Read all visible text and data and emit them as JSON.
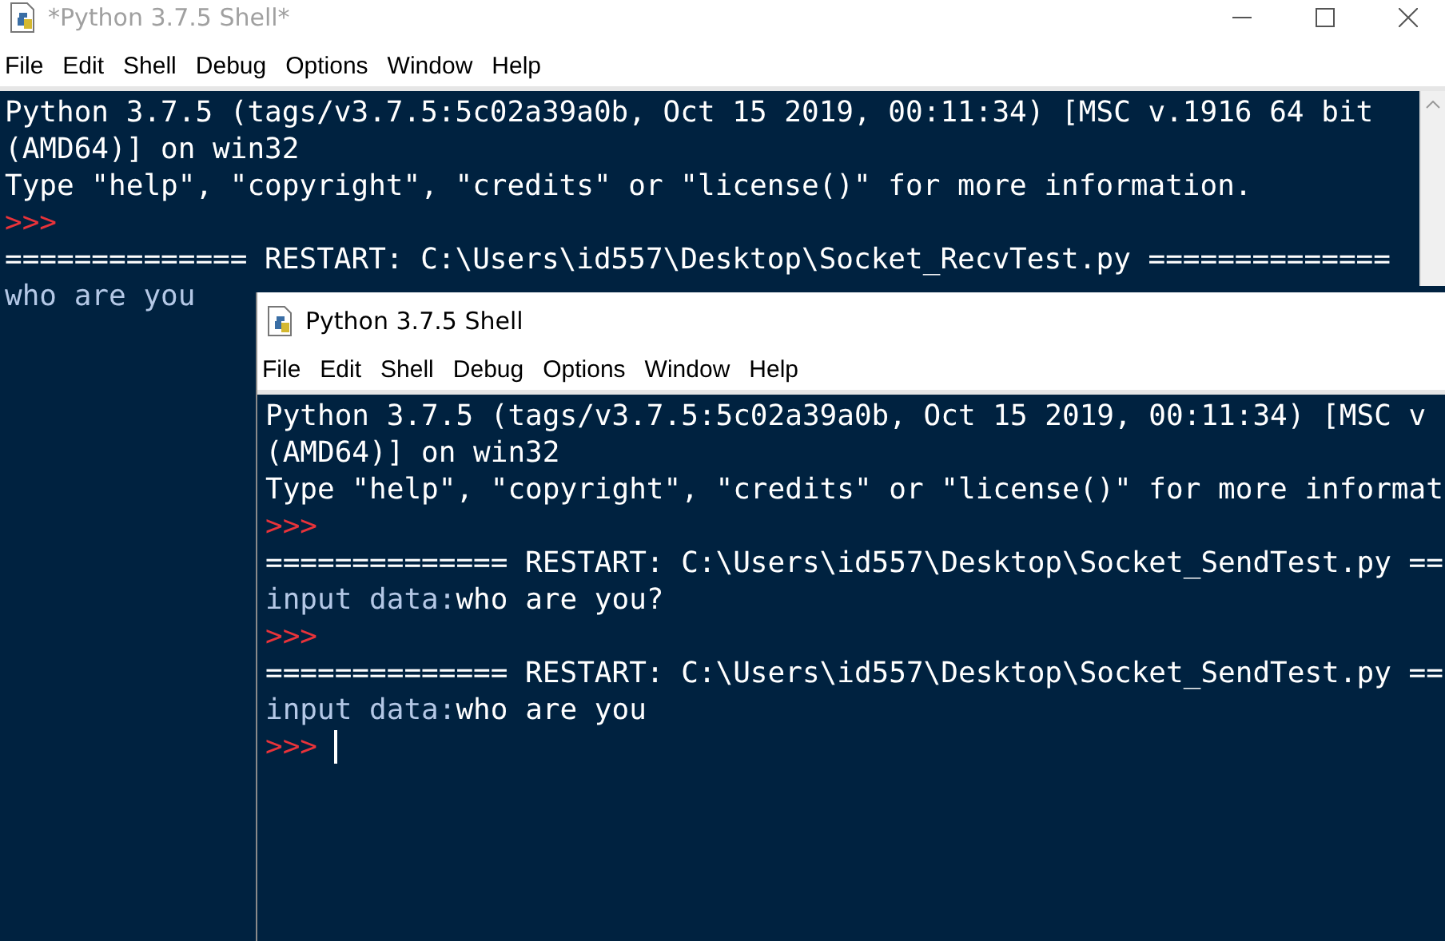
{
  "windows": [
    {
      "title": "*Python 3.7.5 Shell*",
      "active": false,
      "controls_visible": true,
      "scrollbar_visible": true,
      "menu": [
        "File",
        "Edit",
        "Shell",
        "Debug",
        "Options",
        "Window",
        "Help"
      ],
      "lines": [
        [
          {
            "kind": "console",
            "text": "Python 3.7.5 (tags/v3.7.5:5c02a39a0b, Oct 15 2019, 00:11:34) [MSC v.1916 64 bit"
          }
        ],
        [
          {
            "kind": "console",
            "text": "(AMD64)] on win32"
          }
        ],
        [
          {
            "kind": "console",
            "text": "Type \"help\", \"copyright\", \"credits\" or \"license()\" for more information."
          }
        ],
        [
          {
            "kind": "prompt",
            "text": ">>>"
          }
        ],
        [
          {
            "kind": "console",
            "text": "============== RESTART: C:\\Users\\id557\\Desktop\\Socket_RecvTest.py =============="
          }
        ],
        [
          {
            "kind": "stdout",
            "text": "who are you"
          }
        ]
      ]
    },
    {
      "title": "Python 3.7.5 Shell",
      "active": true,
      "controls_visible": false,
      "scrollbar_visible": false,
      "menu": [
        "File",
        "Edit",
        "Shell",
        "Debug",
        "Options",
        "Window",
        "Help"
      ],
      "lines": [
        [
          {
            "kind": "console",
            "text": "Python 3.7.5 (tags/v3.7.5:5c02a39a0b, Oct 15 2019, 00:11:34) [MSC v"
          }
        ],
        [
          {
            "kind": "console",
            "text": "(AMD64)] on win32"
          }
        ],
        [
          {
            "kind": "console",
            "text": "Type \"help\", \"copyright\", \"credits\" or \"license()\" for more informat"
          }
        ],
        [
          {
            "kind": "prompt",
            "text": ">>>"
          }
        ],
        [
          {
            "kind": "console",
            "text": "============== RESTART: C:\\Users\\id557\\Desktop\\Socket_SendTest.py =="
          }
        ],
        [
          {
            "kind": "stdout",
            "text": "input data:"
          },
          {
            "kind": "stdin",
            "text": "who are you?"
          }
        ],
        [
          {
            "kind": "prompt",
            "text": ">>>"
          }
        ],
        [
          {
            "kind": "console",
            "text": "============== RESTART: C:\\Users\\id557\\Desktop\\Socket_SendTest.py =="
          }
        ],
        [
          {
            "kind": "stdout",
            "text": "input data:"
          },
          {
            "kind": "stdin",
            "text": "who are you"
          }
        ],
        [
          {
            "kind": "prompt",
            "text": ">>> "
          },
          {
            "kind": "cursor"
          }
        ]
      ]
    }
  ]
}
